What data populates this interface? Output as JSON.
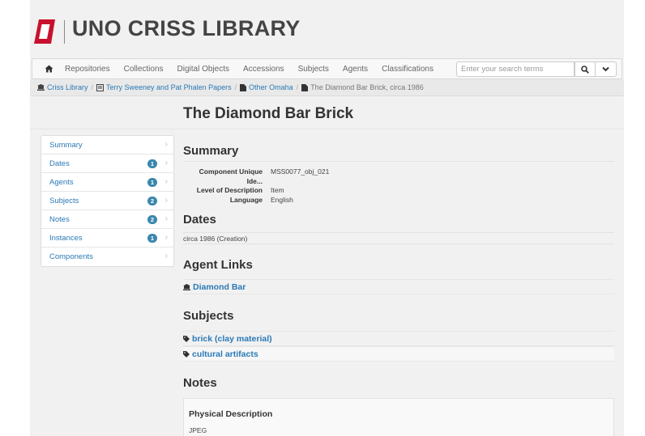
{
  "header": {
    "site_title": "UNO CRISS LIBRARY"
  },
  "nav": {
    "items": [
      "Repositories",
      "Collections",
      "Digital Objects",
      "Accessions",
      "Subjects",
      "Agents",
      "Classifications"
    ],
    "search_placeholder": "Enter your search terms"
  },
  "breadcrumb": {
    "items": [
      "Criss Library",
      "Terry Sweeney and Pat Phalen Papers",
      "Other Omaha"
    ],
    "current": "The Diamond Bar Brick, circa 1986"
  },
  "page_title": "The Diamond Bar Brick",
  "sidebar": {
    "items": [
      {
        "label": "Summary",
        "badge": ""
      },
      {
        "label": "Dates",
        "badge": "1"
      },
      {
        "label": "Agents",
        "badge": "1"
      },
      {
        "label": "Subjects",
        "badge": "2"
      },
      {
        "label": "Notes",
        "badge": "2"
      },
      {
        "label": "Instances",
        "badge": "1"
      },
      {
        "label": "Components",
        "badge": ""
      }
    ]
  },
  "summary": {
    "heading": "Summary",
    "rows": [
      {
        "key": "Component Unique Ide...",
        "value": "MSS0077_obj_021"
      },
      {
        "key": "Level of Description",
        "value": "Item"
      },
      {
        "key": "Language",
        "value": "English"
      }
    ]
  },
  "dates": {
    "heading": "Dates",
    "value": "circa 1986 (Creation)"
  },
  "agent_links": {
    "heading": "Agent Links",
    "items": [
      "Diamond Bar"
    ]
  },
  "subjects": {
    "heading": "Subjects",
    "items": [
      "brick (clay material)",
      "cultural artifacts"
    ]
  },
  "notes": {
    "heading": "Notes",
    "items": [
      {
        "title": "Physical Description",
        "value": "JPEG"
      }
    ]
  },
  "colors": {
    "link": "#2a79b5",
    "badge": "#3a87ad",
    "logo_red": "#c8102e"
  }
}
